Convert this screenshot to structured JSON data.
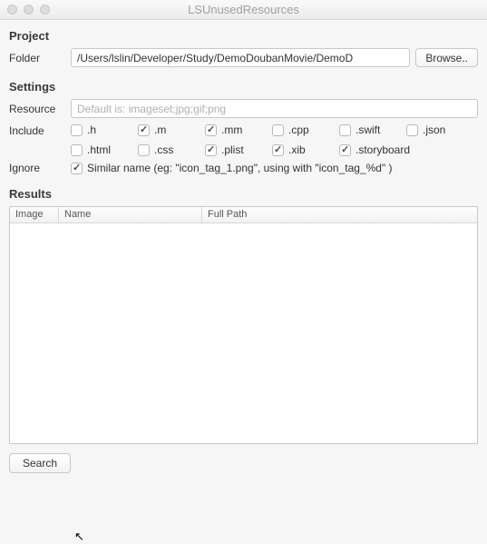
{
  "window": {
    "title": "LSUnusedResources"
  },
  "project": {
    "heading": "Project",
    "folder_label": "Folder",
    "folder_value": "/Users/lslin/Developer/Study/DemoDoubanMovie/DemoD",
    "browse_label": "Browse.."
  },
  "settings": {
    "heading": "Settings",
    "resource_label": "Resource",
    "resource_placeholder": "Default is: imageset;jpg;gif;png",
    "resource_value": "",
    "include_label": "Include",
    "include_items": [
      {
        "label": ".h",
        "checked": false
      },
      {
        "label": ".m",
        "checked": true
      },
      {
        "label": ".mm",
        "checked": true
      },
      {
        "label": ".cpp",
        "checked": false
      },
      {
        "label": ".swift",
        "checked": false
      },
      {
        "label": ".json",
        "checked": false
      },
      {
        "label": ".html",
        "checked": false
      },
      {
        "label": ".css",
        "checked": false
      },
      {
        "label": ".plist",
        "checked": true
      },
      {
        "label": ".xib",
        "checked": true
      },
      {
        "label": ".storyboard",
        "checked": true
      }
    ],
    "ignore_label": "Ignore",
    "ignore_checked": true,
    "ignore_text": "Similar name (eg: \"icon_tag_1.png\", using with \"icon_tag_%d\" )"
  },
  "results": {
    "heading": "Results",
    "columns": {
      "image": "Image",
      "name": "Name",
      "full_path": "Full Path"
    },
    "rows": []
  },
  "footer": {
    "search_label": "Search"
  }
}
